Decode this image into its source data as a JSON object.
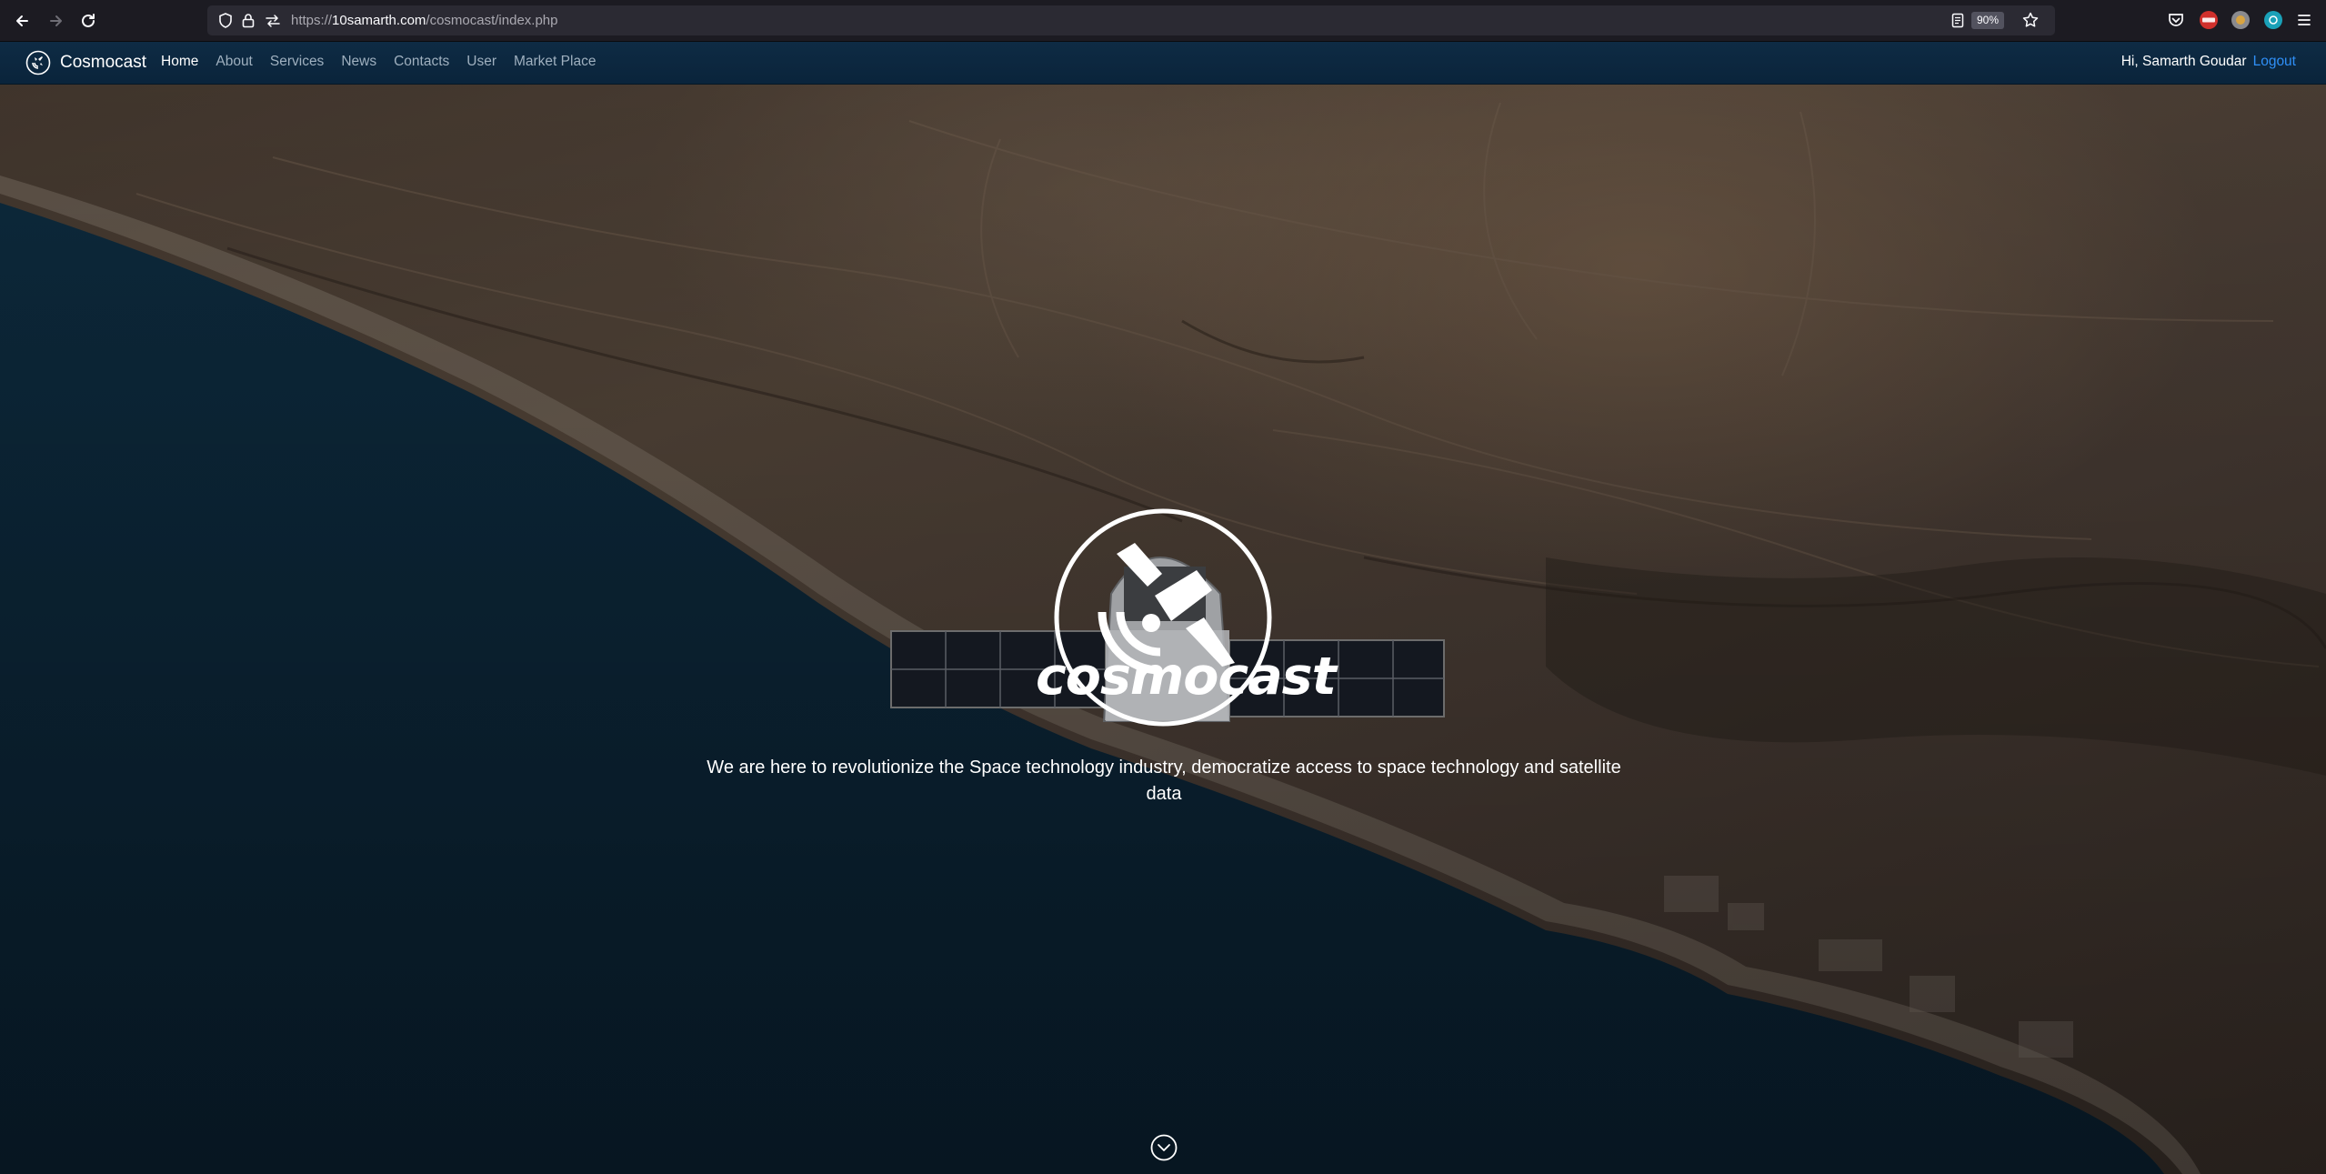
{
  "browser": {
    "url_domain": "10samarth.com",
    "url_prefix": "https://",
    "url_path": "/cosmocast/index.php",
    "zoom": "90%"
  },
  "site": {
    "brand": "Cosmocast",
    "nav": [
      "Home",
      "About",
      "Services",
      "News",
      "Contacts",
      "User",
      "Market Place"
    ],
    "active": "Home",
    "greeting": "Hi, Samarth Goudar",
    "logout": "Logout"
  },
  "hero": {
    "logo_word": "cosmocast",
    "tagline": "We are here to revolutionize the Space technology industry, democratize access to space technology and satellite data"
  },
  "icons": {
    "back": "arrow-left-icon",
    "forward": "arrow-right-icon",
    "reload": "reload-icon",
    "scroll": "chevron-down-circle-icon"
  }
}
